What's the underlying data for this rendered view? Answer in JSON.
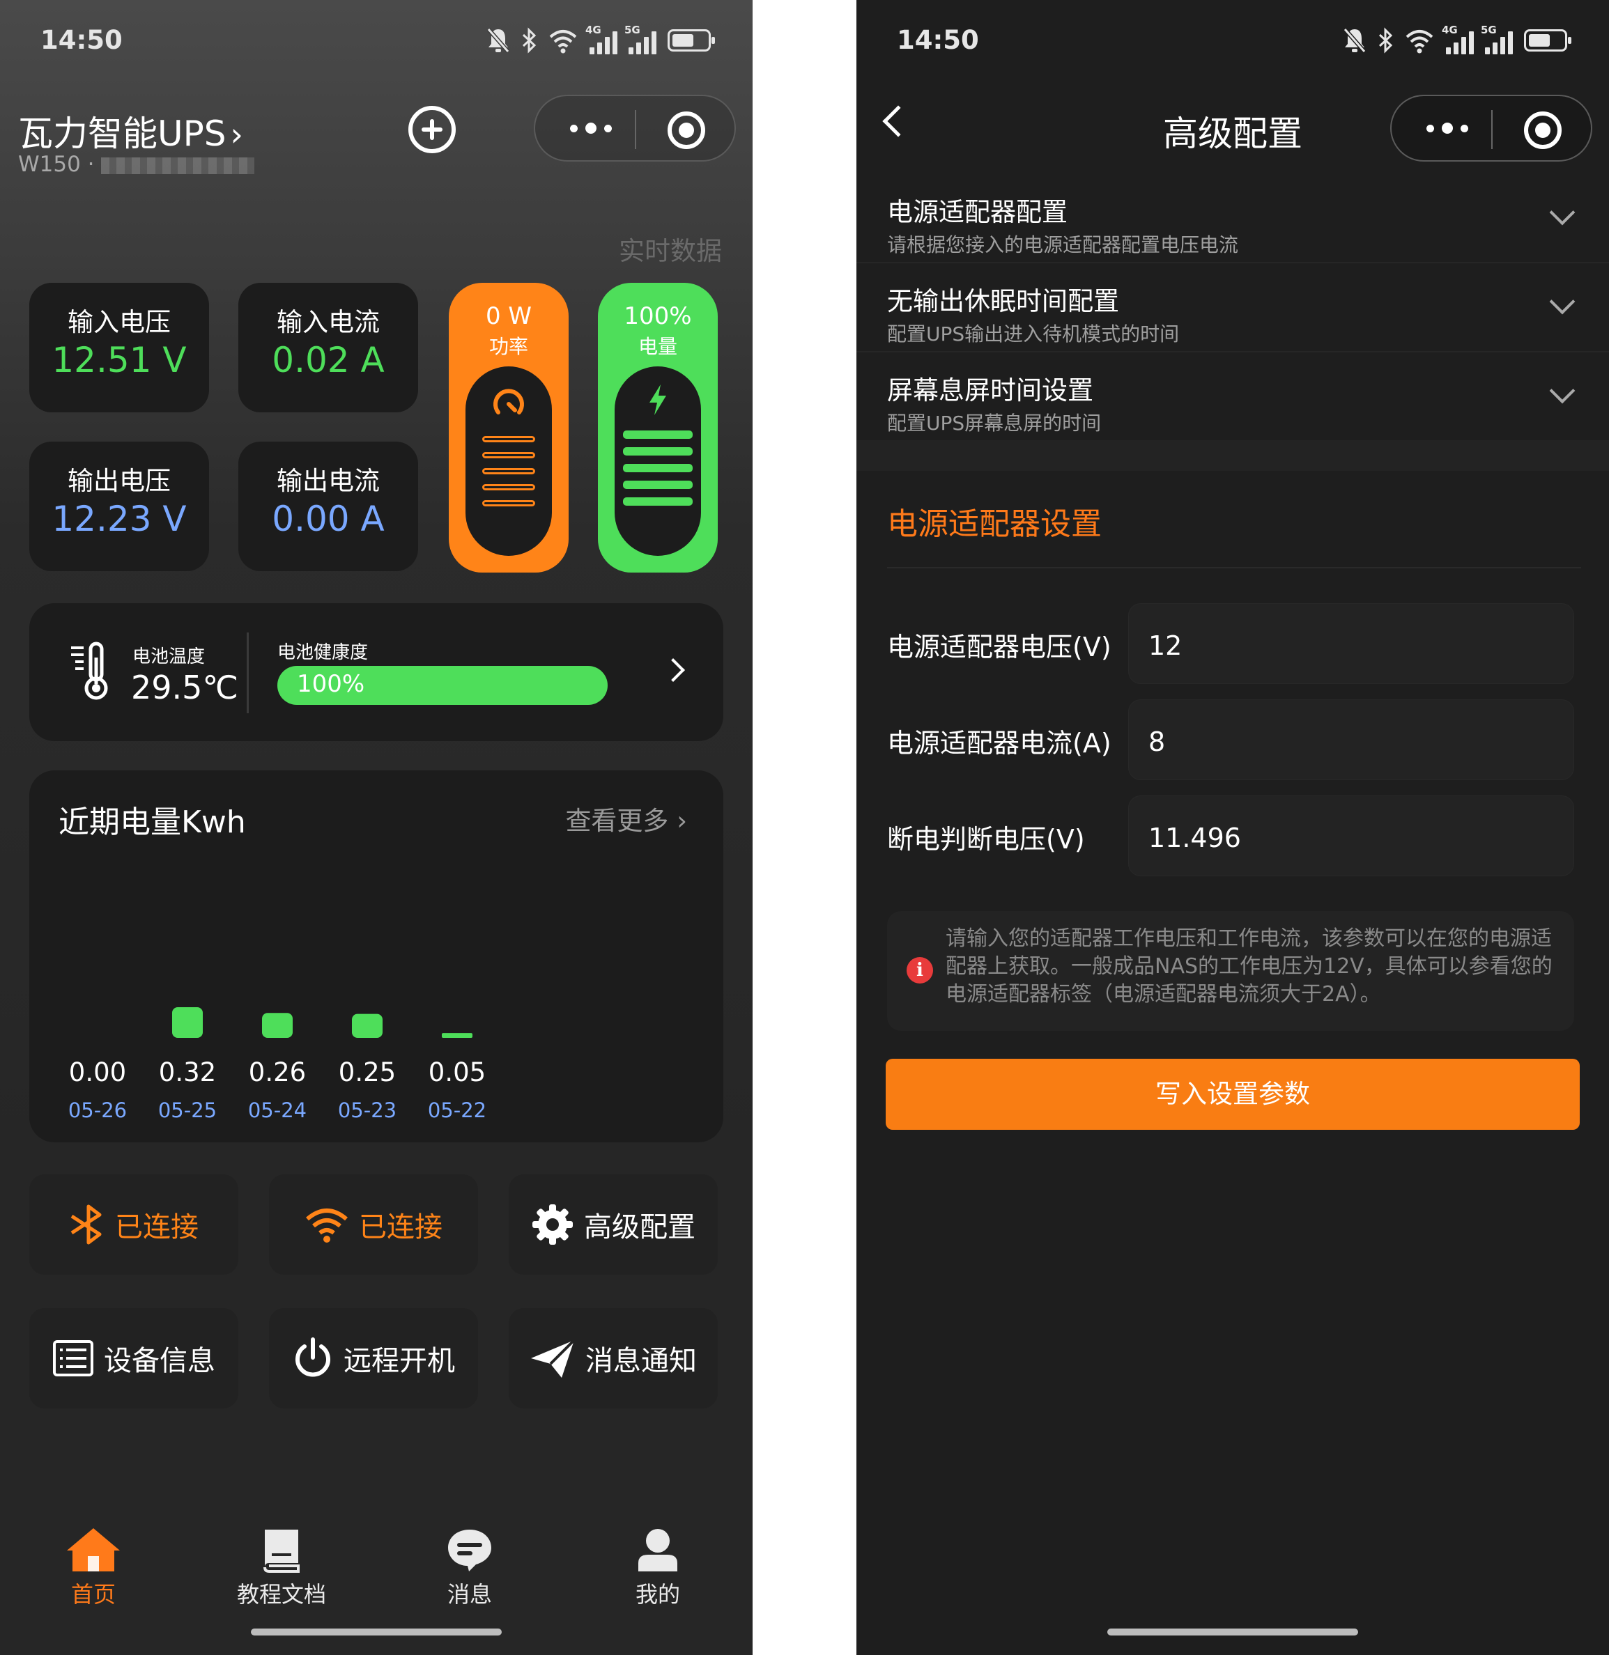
{
  "left": {
    "status": {
      "time": "14:50",
      "sig_4g": "4G",
      "sig_5g": "5G"
    },
    "header": {
      "title": "瓦力智能UPS",
      "chevron": "›",
      "subtitle": "W150 ·"
    },
    "realtime_label": "实时数据",
    "tiles": [
      {
        "label": "输入电压",
        "value": "12.51 V"
      },
      {
        "label": "输入电流",
        "value": "0.02 A"
      },
      {
        "label": "输出电压",
        "value": "12.23 V"
      },
      {
        "label": "输出电流",
        "value": "0.00 A"
      }
    ],
    "power_pill": {
      "value": "0 W",
      "label": "功率"
    },
    "charge_pill": {
      "value": "100%",
      "label": "电量"
    },
    "battery": {
      "temp_label": "电池温度",
      "temp_value": "29.5℃",
      "health_label": "电池健康度",
      "health_value": "100%",
      "health_fraction": 1.0
    },
    "chart_card": {
      "title": "近期电量Kwh",
      "more": "查看更多"
    },
    "buttons": {
      "bluetooth": "已连接",
      "wifi": "已连接",
      "advanced": "高级配置",
      "device_info": "设备信息",
      "remote_power": "远程开机",
      "notify": "消息通知"
    },
    "tabbar": [
      {
        "label": "首页",
        "icon": "home-icon",
        "active": true
      },
      {
        "label": "教程文档",
        "icon": "book-icon",
        "active": false
      },
      {
        "label": "消息",
        "icon": "chat-icon",
        "active": false
      },
      {
        "label": "我的",
        "icon": "user-icon",
        "active": false
      }
    ],
    "colors": {
      "orange": "#ff8418",
      "green": "#4ede5a",
      "blue": "#7aa8ff"
    }
  },
  "chart_data": {
    "type": "bar",
    "categories": [
      "05-26",
      "05-25",
      "05-24",
      "05-23",
      "05-22"
    ],
    "values": [
      0.0,
      0.32,
      0.26,
      0.25,
      0.05
    ],
    "value_labels": [
      "0.00",
      "0.32",
      "0.26",
      "0.25",
      "0.05"
    ],
    "title": "近期电量Kwh",
    "xlabel": "",
    "ylabel": "",
    "ylim": [
      0,
      0.32
    ],
    "grid": false,
    "color": "#4ede5a"
  },
  "right": {
    "status": {
      "time": "14:50",
      "sig_4g": "4G",
      "sig_5g": "5G"
    },
    "title": "高级配置",
    "accordions": [
      {
        "title": "电源适配器配置",
        "subtitle": "请根据您接入的电源适配器配置电压电流"
      },
      {
        "title": "无输出休眠时间配置",
        "subtitle": "配置UPS输出进入待机模式的时间"
      },
      {
        "title": "屏幕息屏时间设置",
        "subtitle": "配置UPS屏幕息屏的时间"
      }
    ],
    "section_title": "电源适配器设置",
    "fields": [
      {
        "label": "电源适配器电压(V)",
        "value": "12"
      },
      {
        "label": "电源适配器电流(A)",
        "value": "8"
      },
      {
        "label": "断电判断电压(V)",
        "value": "11.496"
      }
    ],
    "note": "请输入您的适配器工作电压和工作电流，该参数可以在您的电源适配器上获取。一般成品NAS的工作电压为12V，具体可以参看您的电源适配器标签（电源适配器电流须大于2A）。",
    "note_icon": "i",
    "submit": "写入设置参数"
  }
}
